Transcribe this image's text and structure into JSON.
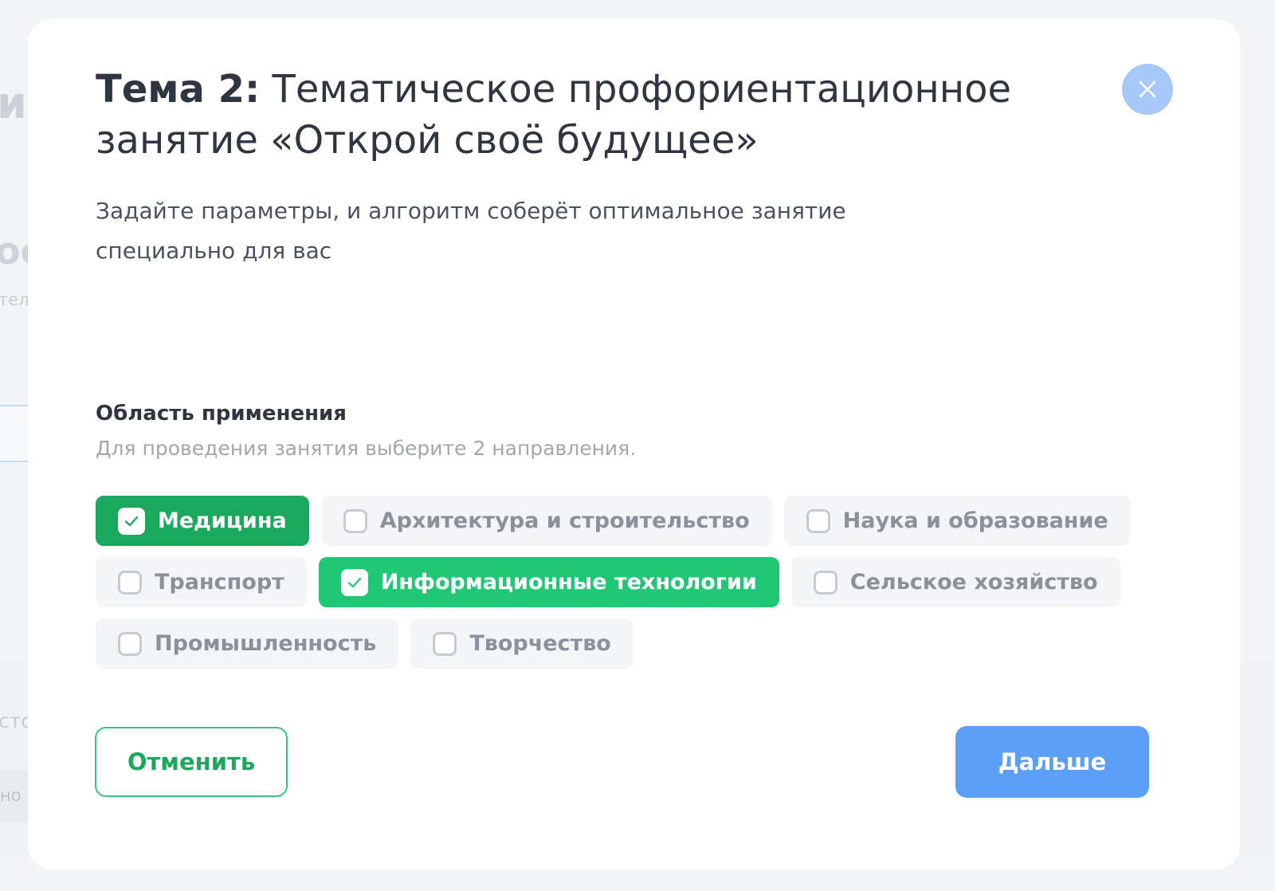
{
  "background": {
    "heading_fragment": "ия",
    "heading2_fragment": "ос",
    "caption_fragment": "тел",
    "panel_fragment_1": "сто",
    "panel_fragment_2": "но"
  },
  "modal": {
    "title_prefix": "Тема 2:",
    "title": "Тематическое профориентационное занятие «Открой своё будущее»",
    "subtitle": "Задайте параметры, и алгоритм соберёт оптимальное занятие специально для вас",
    "close_icon": "close-icon",
    "section_label": "Область применения",
    "section_hint": "Для проведения занятия выберите 2 направления.",
    "options": [
      {
        "label": "Медицина",
        "selected": true
      },
      {
        "label": "Архитектура и строительство",
        "selected": false
      },
      {
        "label": "Наука и образование",
        "selected": false
      },
      {
        "label": "Транспорт",
        "selected": false
      },
      {
        "label": "Информационные технологии",
        "selected": true
      },
      {
        "label": "Сельское хозяйство",
        "selected": false
      },
      {
        "label": "Промышленность",
        "selected": false
      },
      {
        "label": "Творчество",
        "selected": false
      }
    ],
    "cancel_label": "Отменить",
    "next_label": "Дальше"
  },
  "colors": {
    "selected_dark": "#1aa85c",
    "selected_light": "#20c875",
    "primary_blue": "#5b9ff8",
    "close_blue": "#a7c9fa"
  }
}
